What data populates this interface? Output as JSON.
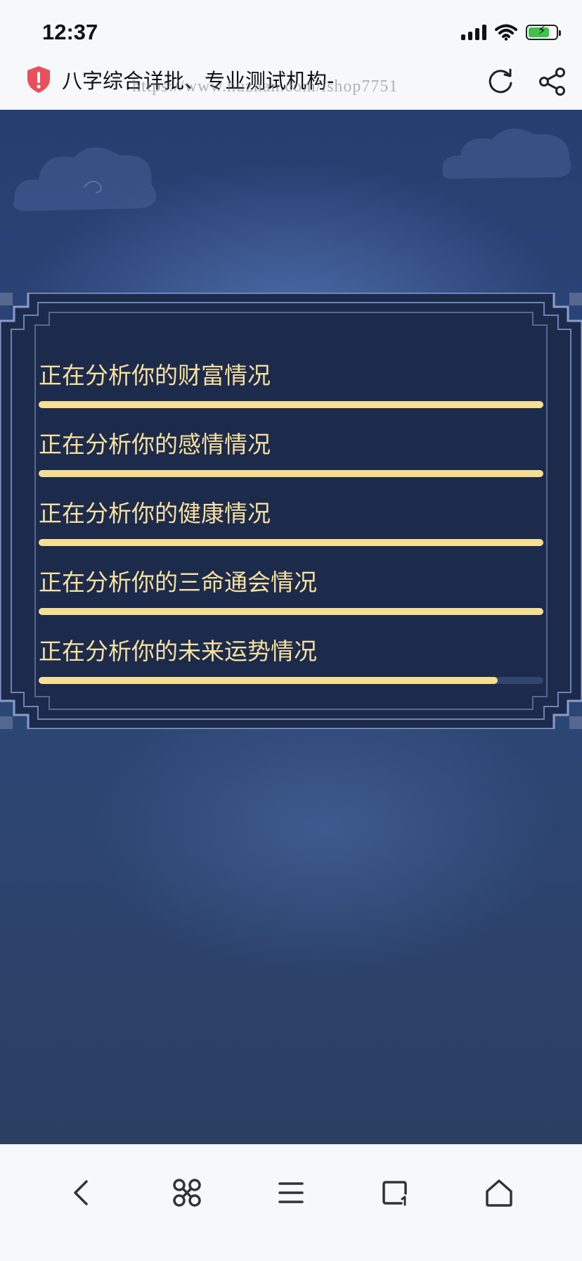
{
  "status_bar": {
    "time": "12:37"
  },
  "address_bar": {
    "title": "八字综合详批、专业测试机构-",
    "watermark": "https://www.huzhan.com/ishop7751"
  },
  "progress_items": [
    {
      "label": "正在分析你的财富情况",
      "progress": 1.0
    },
    {
      "label": "正在分析你的感情情况",
      "progress": 1.0
    },
    {
      "label": "正在分析你的健康情况",
      "progress": 1.0
    },
    {
      "label": "正在分析你的三命通会情况",
      "progress": 1.0
    },
    {
      "label": "正在分析你的未来运势情况",
      "progress": 0.91
    }
  ],
  "colors": {
    "accent": "#f6df90",
    "panel": "#1c2a4c",
    "frame": "#8b9ccc",
    "warning": "#e8505b"
  },
  "icons": {
    "address_bar": [
      "security-warning-icon",
      "reload-icon",
      "share-icon"
    ],
    "bottom_nav": [
      "back-icon",
      "command-icon",
      "menu-icon",
      "tabs-icon",
      "home-icon"
    ]
  }
}
